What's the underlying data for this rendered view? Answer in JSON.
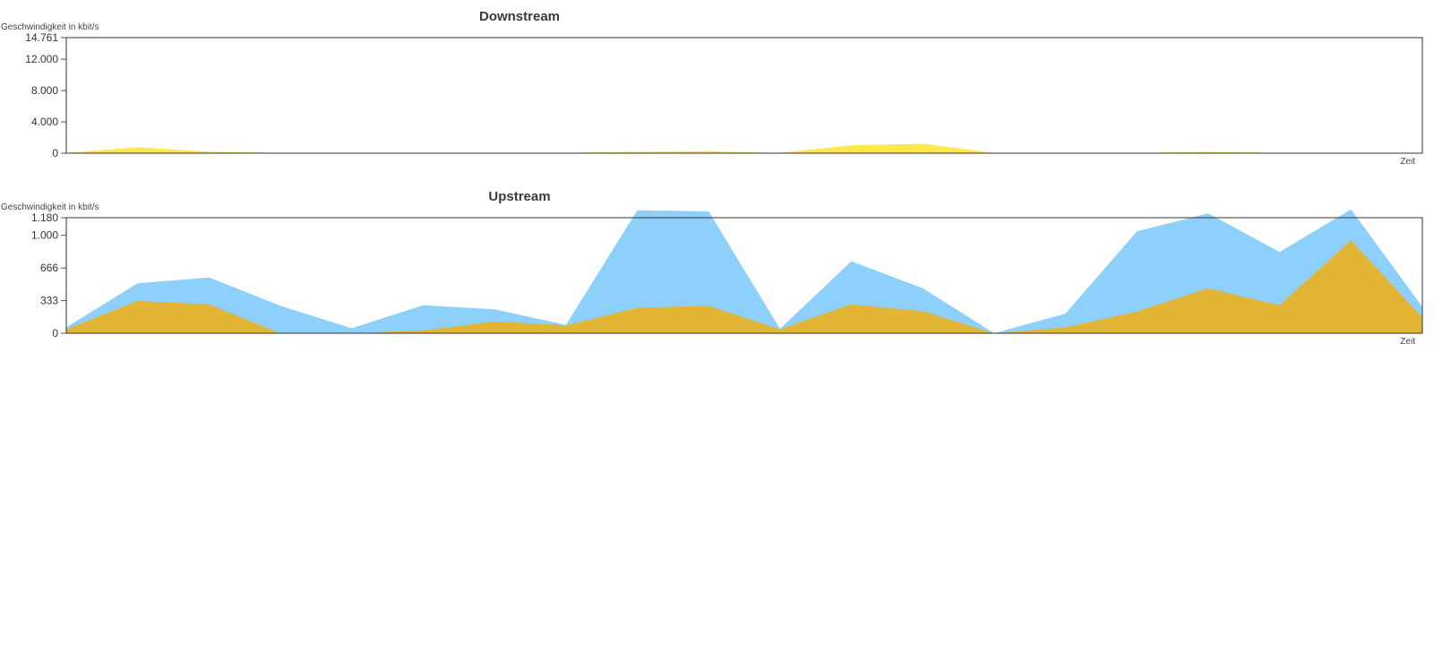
{
  "chart_data": [
    {
      "id": "downstream",
      "type": "area",
      "title": "Downstream",
      "ylabel": "Geschwindigkeit in kbit/s",
      "xlabel": "Zeit",
      "ylim": [
        0,
        14761
      ],
      "yticks": [
        0,
        4000,
        8000,
        12000,
        14761
      ],
      "ytick_labels": [
        "0",
        "4.000",
        "8.000",
        "12.000",
        "14.761"
      ],
      "grid": false,
      "x": [
        0,
        1,
        2,
        3,
        4,
        5,
        6,
        7,
        8,
        9,
        10,
        11,
        12,
        13,
        14,
        15,
        16,
        17,
        18,
        19
      ],
      "series": [
        {
          "color": "#ffe74c",
          "values": [
            50,
            750,
            200,
            50,
            30,
            30,
            30,
            30,
            180,
            250,
            30,
            1000,
            1200,
            30,
            30,
            30,
            180,
            40,
            40,
            60
          ]
        }
      ]
    },
    {
      "id": "upstream",
      "type": "area",
      "title": "Upstream",
      "ylabel": "Geschwindigkeit in kbit/s",
      "xlabel": "Zeit",
      "ylim": [
        0,
        1180
      ],
      "yticks": [
        0,
        333,
        666,
        1000,
        1180
      ],
      "ytick_labels": [
        "0",
        "333",
        "666",
        "1.000",
        "1.180"
      ],
      "grid": false,
      "x": [
        0,
        1,
        2,
        3,
        4,
        5,
        6,
        7,
        8,
        9,
        10,
        11,
        12,
        13,
        14,
        15,
        16,
        17,
        18,
        19
      ],
      "series": [
        {
          "color": "#8dd0fc",
          "values": [
            60,
            510,
            570,
            280,
            50,
            285,
            245,
            85,
            1255,
            1245,
            45,
            735,
            460,
            0,
            200,
            1040,
            1225,
            830,
            1265,
            270
          ]
        },
        {
          "color": "#e3b534",
          "values": [
            40,
            330,
            295,
            0,
            0,
            30,
            120,
            80,
            260,
            280,
            40,
            295,
            225,
            0,
            60,
            220,
            460,
            285,
            950,
            160
          ]
        }
      ]
    }
  ]
}
